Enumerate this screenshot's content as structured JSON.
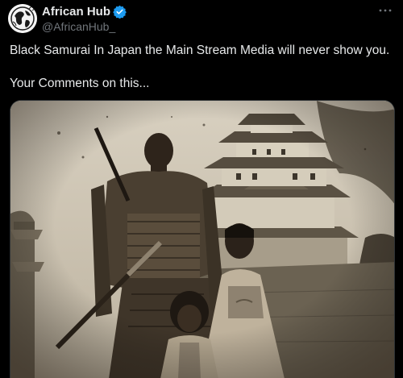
{
  "account": {
    "display_name": "African Hub",
    "handle": "@AfricanHub_",
    "avatar_icon": "globe-avatar-icon",
    "verified_color": "#1d9bf0"
  },
  "menu": {
    "more_icon": "more-options-icon"
  },
  "tweet": {
    "line1": "Black Samurai In Japan the Main Stream Media will never show you.",
    "line2": "Your Comments on this..."
  },
  "colors": {
    "background": "#000000",
    "text_primary": "#e7e9ea",
    "text_secondary": "#71767b",
    "photo_tone": "#c9c0ae"
  }
}
